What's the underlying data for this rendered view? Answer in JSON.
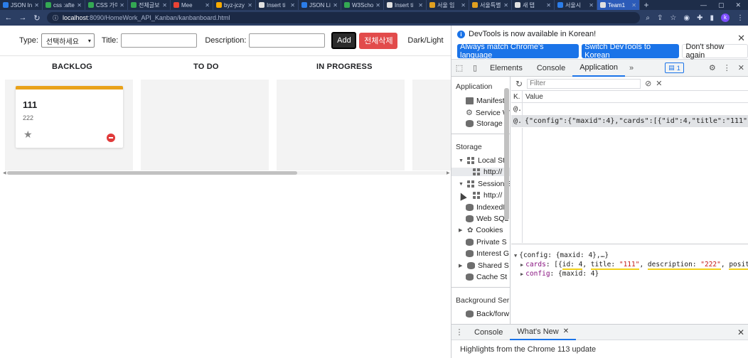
{
  "browser": {
    "tabs": [
      {
        "label": "JSON In",
        "color": "#2b7de9"
      },
      {
        "label": "css :after",
        "color": "#34a853"
      },
      {
        "label": "CSS 가이",
        "color": "#34a853"
      },
      {
        "label": "전체글보",
        "color": "#34a853"
      },
      {
        "label": "Mee",
        "color": "#ea4335"
      },
      {
        "label": "byz-jczy",
        "color": "#f9ab00"
      },
      {
        "label": "Insert ti",
        "color": "#e0e0e0"
      },
      {
        "label": "JSON Lit",
        "color": "#2b7de9"
      },
      {
        "label": "W3Scho",
        "color": "#34a853"
      },
      {
        "label": "Insert ti",
        "color": "#e0e0e0"
      },
      {
        "label": "서울 임",
        "color": "#e0a020"
      },
      {
        "label": "서울특별",
        "color": "#e0a020"
      },
      {
        "label": "새 탭",
        "color": "#e0e0e0"
      },
      {
        "label": "서울시",
        "color": "#2b7de9"
      },
      {
        "label": "Team1",
        "color": "#e0e0e0"
      }
    ],
    "new_tab": "+",
    "url_host": "localhost",
    "url_path": ":8090/HomeWork_API_Kanban/kanbanboard.html",
    "profile_initial": "k"
  },
  "form": {
    "type_label": "Type:",
    "type_value": "선택하세요",
    "title_label": "Title:",
    "title_value": "",
    "desc_label": "Description:",
    "desc_value": "",
    "add_label": "Add",
    "delete_all_label": "전체삭제",
    "theme_toggle_label": "Dark/Light"
  },
  "board": {
    "columns": [
      "BACKLOG",
      "TO DO",
      "IN PROGRESS"
    ],
    "cards": [
      {
        "title": "111",
        "description": "222",
        "star": "★"
      }
    ]
  },
  "devtools": {
    "banner_message": "DevTools is now available in Korean!",
    "banner_btn1": "Always match Chrome's language",
    "banner_btn2": "Switch DevTools to Korean",
    "banner_btn3": "Don't show again",
    "tabs": [
      "Elements",
      "Console",
      "Application"
    ],
    "active_tab": "Application",
    "more": "»",
    "issues_count": "1",
    "sidebar": {
      "app_header": "Application",
      "app_items": [
        "Manifest",
        "Service W",
        "Storage"
      ],
      "storage_header": "Storage",
      "storage_items": [
        "Local Sto",
        "http://",
        "Session S",
        "http://",
        "IndexedD",
        "Web SQL",
        "Cookies",
        "Private S",
        "Interest G",
        "Shared S",
        "Cache St"
      ],
      "bg_header": "Background Ser",
      "bg_items": [
        "Back/forw"
      ]
    },
    "filter_placeholder": "Filter",
    "table": {
      "key_header": "K.",
      "value_header": "Value",
      "rows": [
        {
          "key": "@.",
          "value": ""
        },
        {
          "key": "@.",
          "value": "{\"config\":{\"maxid\":4},\"cards\":[{\"id\":4,\"title\":\"111\",\"description\":\"222\",\"..."
        }
      ]
    },
    "preview": {
      "root": "{config: {maxid: 4},…}",
      "cards_key": "cards",
      "cards_open": "[{",
      "cards_id": "id: 4",
      "cards_title_key": "title: ",
      "cards_title_val": "\"111\"",
      "cards_desc_key": "description: ",
      "cards_desc_val": "\"222\"",
      "cards_pos": "positio",
      "config_key": "config",
      "config_val": "{maxid: 4}"
    },
    "drawer": {
      "tabs": [
        "Console",
        "What's New"
      ],
      "active": "What's New",
      "body": "Highlights from the Chrome 113 update"
    }
  }
}
